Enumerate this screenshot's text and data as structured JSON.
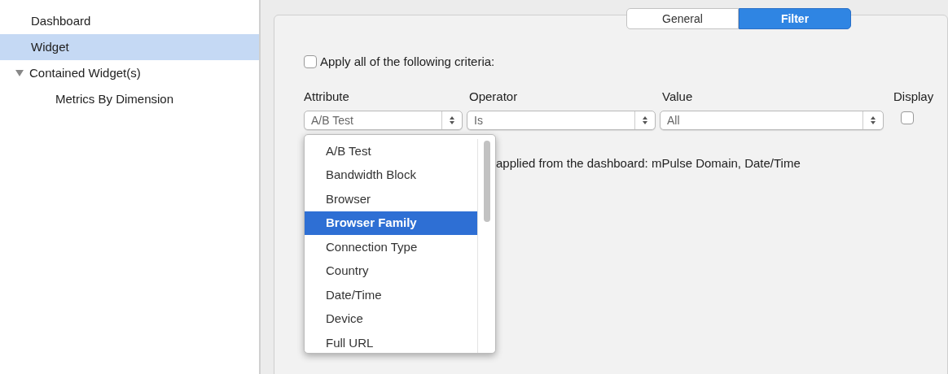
{
  "sidebar": {
    "items": [
      {
        "label": "Dashboard",
        "selected": false
      },
      {
        "label": "Widget",
        "selected": true
      },
      {
        "label": "Contained Widget(s)",
        "selected": false,
        "expanded": true,
        "children": [
          {
            "label": "Metrics By Dimension",
            "selected": false
          }
        ]
      }
    ]
  },
  "tabs": [
    {
      "label": "General",
      "selected": false
    },
    {
      "label": "Filter",
      "selected": true
    }
  ],
  "apply_all": {
    "label": "Apply all of the following criteria:",
    "checked": false
  },
  "columns": [
    "Attribute",
    "Operator",
    "Value",
    "Display"
  ],
  "filter_row": {
    "attribute": "A/B Test",
    "operator": "Is",
    "value": "All",
    "display": false
  },
  "note": "applied from the dashboard: mPulse Domain, Date/Time",
  "attribute_menu": [
    {
      "label": "A/B Test",
      "selected": false
    },
    {
      "label": "Bandwidth Block",
      "selected": false
    },
    {
      "label": "Browser",
      "selected": false
    },
    {
      "label": "Browser Family",
      "selected": true
    },
    {
      "label": "Connection Type",
      "selected": false
    },
    {
      "label": "Country",
      "selected": false
    },
    {
      "label": "Date/Time",
      "selected": false
    },
    {
      "label": "Device",
      "selected": false
    },
    {
      "label": "Full URL",
      "selected": false
    }
  ]
}
